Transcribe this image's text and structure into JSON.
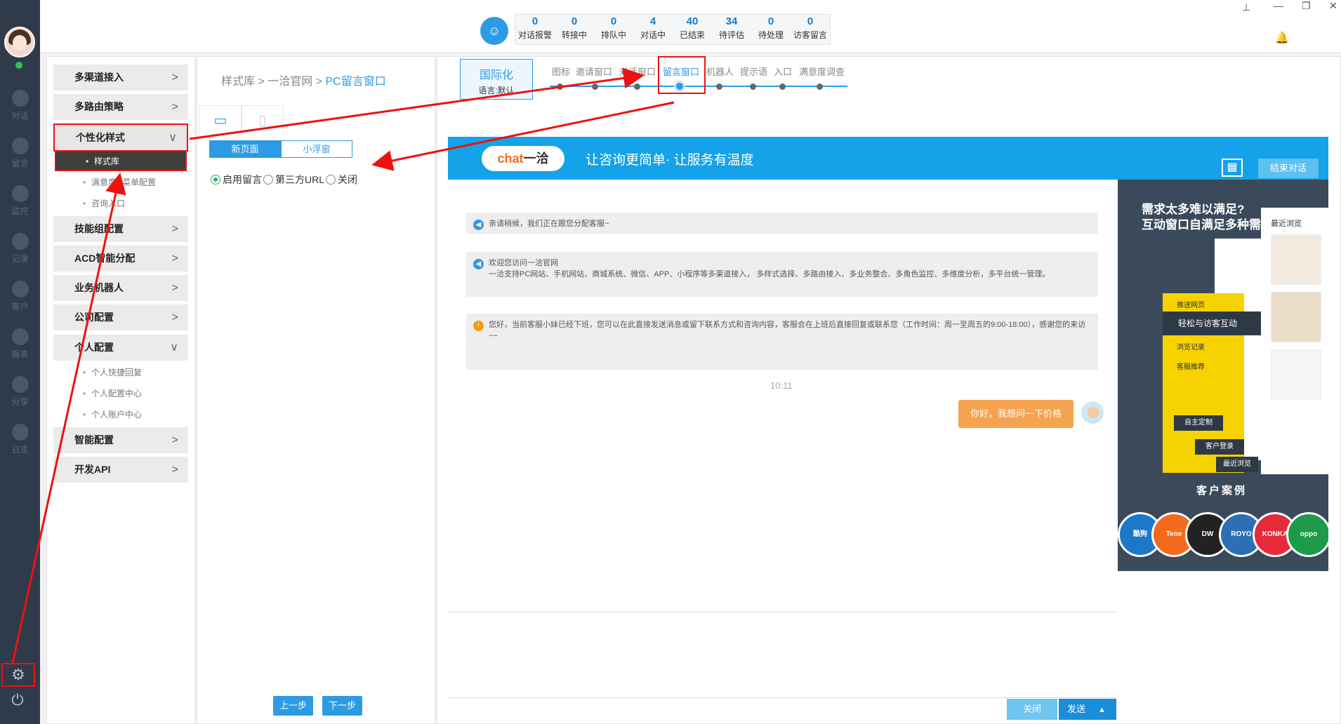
{
  "rail": {
    "items": [
      "对话",
      "留言",
      "监控",
      "记录",
      "客户",
      "报表",
      "分享",
      "日志"
    ]
  },
  "topbar": {
    "stats": [
      {
        "num": "0",
        "label": "对话报警"
      },
      {
        "num": "0",
        "label": "转接中"
      },
      {
        "num": "0",
        "label": "排队中"
      },
      {
        "num": "4",
        "label": "对话中"
      },
      {
        "num": "40",
        "label": "已结束"
      },
      {
        "num": "34",
        "label": "待评估"
      },
      {
        "num": "0",
        "label": "待处理"
      },
      {
        "num": "0",
        "label": "访客留言"
      }
    ]
  },
  "menu": {
    "items": [
      {
        "label": "多渠道接入",
        "chev": ">"
      },
      {
        "label": "多路由策略",
        "chev": ">"
      },
      {
        "label": "个性化样式",
        "chev": "∨"
      },
      {
        "label": "技能组配置",
        "chev": ">"
      },
      {
        "label": "ACD智能分配",
        "chev": ">"
      },
      {
        "label": "业务机器人",
        "chev": ">"
      },
      {
        "label": "公司配置",
        "chev": ">"
      },
      {
        "label": "个人配置",
        "chev": "∨"
      },
      {
        "label": "智能配置",
        "chev": ">"
      },
      {
        "label": "开发API",
        "chev": ">"
      }
    ],
    "sub_style": [
      "样式库",
      "满意度&菜单配置",
      "咨询入口"
    ],
    "sub_personal": [
      "个人快捷回复",
      "个人配置中心",
      "个人账户中心"
    ]
  },
  "breadcrumb": {
    "a": "样式库",
    "sep1": " > ",
    "b": "一洽官网",
    "sep2": " > ",
    "c": "PC留言窗口"
  },
  "seg": {
    "new_page": "新页面",
    "float": "小浮窗"
  },
  "radios": {
    "enable": "启用留言",
    "third": "第三方URL",
    "off": "关闭"
  },
  "steps_btn": {
    "prev": "上一步",
    "next": "下一步"
  },
  "i18n": {
    "title": "国际化",
    "lang": "语言:默认"
  },
  "steps": [
    "图标",
    "邀请窗口",
    "对话窗口",
    "留言窗口",
    "机器人",
    "提示语",
    "入口",
    "满意度调查"
  ],
  "chat": {
    "logo_a": "chat",
    "logo_b": "一洽",
    "slogan": "让咨询更简单· 让服务有温度",
    "end": "结束对话",
    "msg1": "亲请稍候，我们正在跟您分配客服~",
    "msg2_l1": "欢迎您访问一洽官网",
    "msg2_l2": "一洽支持PC网站、手机网站、商城系统、微信、APP、小程序等多渠道接入， 多样式选择、多路由接入、多业务整合、多角色监控、多维度分析，多平台统一管理。",
    "msg3": "您好，当前客服小妹已经下班，您可以在此直接发送消息或留下联系方式和咨询内容，客服会在上班后直接回复或联系您（工作时间：周一至周五的9:00-18:00），感谢您的来访~~",
    "time": "10:11",
    "user_msg": "你好，我想问一下价格",
    "close": "关闭",
    "send": "发送",
    "send_arrow": "▲"
  },
  "ad": {
    "t1": "需求太多难以满足?",
    "t2": "互动窗口自满足多种需求",
    "recent": "最近浏览",
    "dark_item": "轻松与访客互动",
    "y_items": [
      "推送网页",
      "浏览记录",
      "客服推荐"
    ],
    "custom": "自主定制",
    "login": "客户登录",
    "recent2": "最近浏览",
    "case": "客户案例",
    "brands": [
      "酷狗",
      "Tene",
      "DW",
      "ROYO",
      "KONKA",
      "oppo"
    ]
  },
  "colors": {
    "accent": "#2c9be3",
    "annotation": "#e11111"
  }
}
